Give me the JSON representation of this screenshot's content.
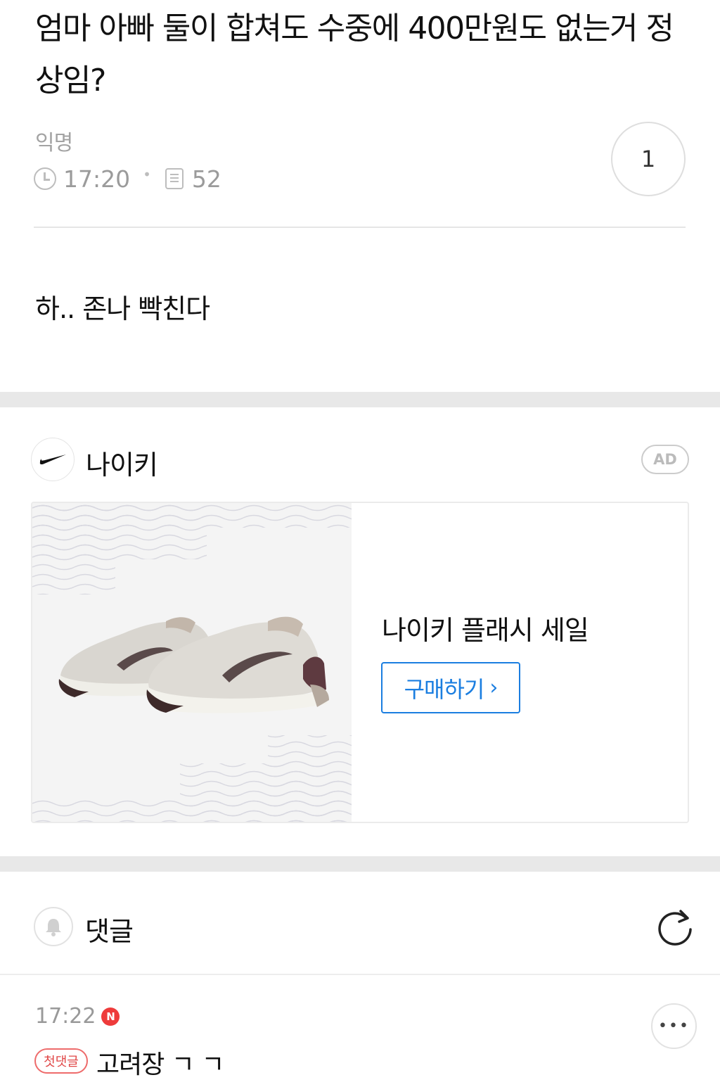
{
  "post": {
    "title": "엄마 아빠 둘이 합쳐도 수중에 400만원도 없는거 정상임?",
    "author": "익명",
    "time": "17:20",
    "views": "52",
    "likes": "1",
    "body": "하.. 존나 빡친다"
  },
  "ad": {
    "brand": "나이키",
    "badge": "AD",
    "headline": "나이키 플래시 세일",
    "cta_label": "구매하기",
    "cta_color": "#1b7ee0"
  },
  "comments": {
    "title": "댓글",
    "items": [
      {
        "time": "17:22",
        "new_badge": "N",
        "first_badge": "첫댓글",
        "text": "고려장 ㄱ ㄱ"
      }
    ]
  },
  "icons": {
    "time": "clock-icon",
    "views": "document-icon",
    "brand_logo": "nike-swoosh-icon",
    "notifications": "bell-icon",
    "refresh": "refresh-icon",
    "comment_menu": "more-icon"
  },
  "colors": {
    "accent": "#1b7ee0",
    "new_badge": "#ee3b3b",
    "first_badge": "#e04646",
    "muted": "#9b9b9b"
  }
}
